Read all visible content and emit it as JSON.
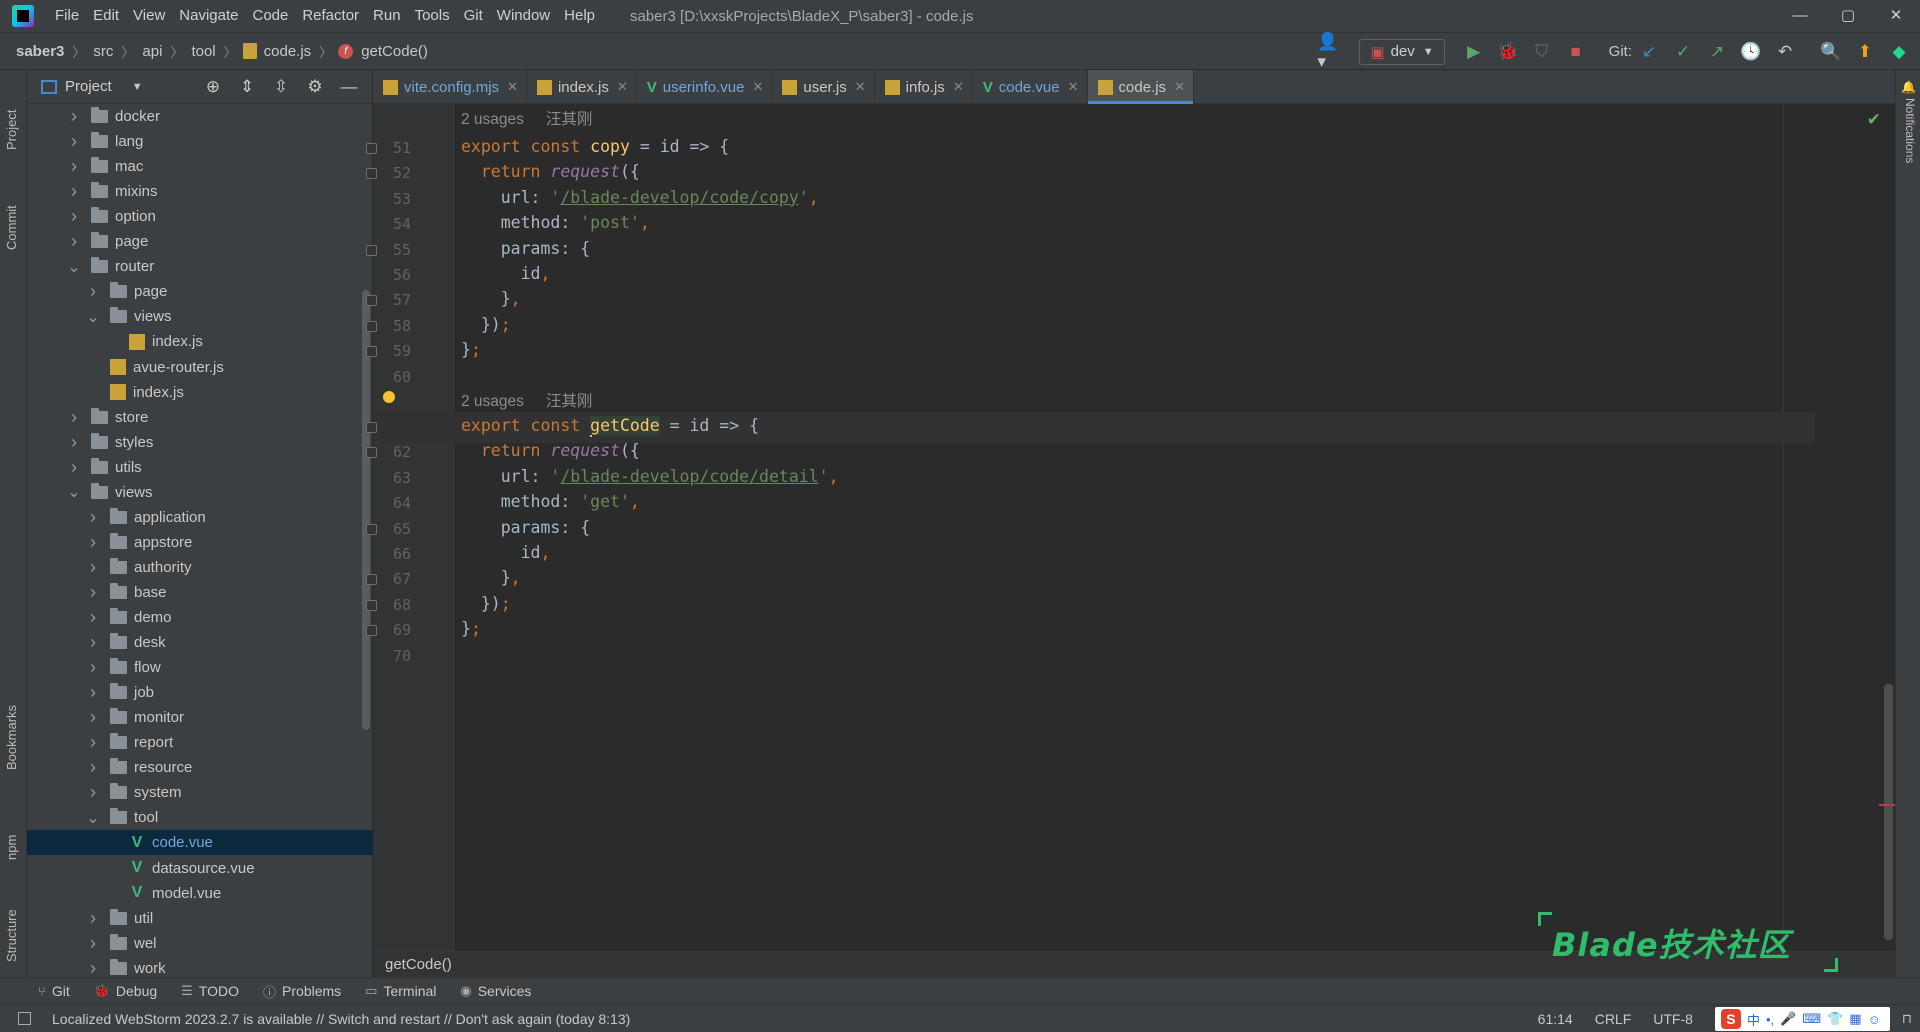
{
  "menubar": {
    "items": [
      "File",
      "Edit",
      "View",
      "Navigate",
      "Code",
      "Refactor",
      "Run",
      "Tools",
      "Git",
      "Window",
      "Help"
    ],
    "window_title": "saber3 [D:\\xxskProjects\\BladeX_P\\saber3] - code.js",
    "controls": [
      "—",
      "▢",
      "✕"
    ]
  },
  "navbar": {
    "crumbs": [
      "saber3",
      "src",
      "api",
      "tool",
      "code.js",
      "getCode()"
    ],
    "branch": "dev",
    "git_label": "Git:"
  },
  "left_strip": {
    "tabs": [
      "Project",
      "Commit",
      "Bookmarks",
      "npm",
      "Structure"
    ]
  },
  "right_strip": {
    "tabs": [
      "Notifications"
    ]
  },
  "project_panel": {
    "title": "Project",
    "tree": [
      {
        "label": "docker",
        "type": "folder",
        "depth": 0,
        "state": "collapsed"
      },
      {
        "label": "lang",
        "type": "folder",
        "depth": 0,
        "state": "collapsed"
      },
      {
        "label": "mac",
        "type": "folder",
        "depth": 0,
        "state": "collapsed"
      },
      {
        "label": "mixins",
        "type": "folder",
        "depth": 0,
        "state": "collapsed"
      },
      {
        "label": "option",
        "type": "folder",
        "depth": 0,
        "state": "collapsed"
      },
      {
        "label": "page",
        "type": "folder",
        "depth": 0,
        "state": "collapsed"
      },
      {
        "label": "router",
        "type": "folder",
        "depth": 0,
        "state": "expanded"
      },
      {
        "label": "page",
        "type": "folder",
        "depth": 1,
        "state": "collapsed"
      },
      {
        "label": "views",
        "type": "folder",
        "depth": 1,
        "state": "expanded"
      },
      {
        "label": "index.js",
        "type": "js",
        "depth": 2,
        "state": "leaf"
      },
      {
        "label": "avue-router.js",
        "type": "js",
        "depth": 1,
        "state": "leaf"
      },
      {
        "label": "index.js",
        "type": "js",
        "depth": 1,
        "state": "leaf"
      },
      {
        "label": "store",
        "type": "folder",
        "depth": 0,
        "state": "collapsed"
      },
      {
        "label": "styles",
        "type": "folder",
        "depth": 0,
        "state": "collapsed"
      },
      {
        "label": "utils",
        "type": "folder",
        "depth": 0,
        "state": "collapsed"
      },
      {
        "label": "views",
        "type": "folder",
        "depth": 0,
        "state": "expanded"
      },
      {
        "label": "application",
        "type": "folder",
        "depth": 1,
        "state": "collapsed"
      },
      {
        "label": "appstore",
        "type": "folder",
        "depth": 1,
        "state": "collapsed"
      },
      {
        "label": "authority",
        "type": "folder",
        "depth": 1,
        "state": "collapsed"
      },
      {
        "label": "base",
        "type": "folder",
        "depth": 1,
        "state": "collapsed"
      },
      {
        "label": "demo",
        "type": "folder",
        "depth": 1,
        "state": "collapsed"
      },
      {
        "label": "desk",
        "type": "folder",
        "depth": 1,
        "state": "collapsed"
      },
      {
        "label": "flow",
        "type": "folder",
        "depth": 1,
        "state": "collapsed"
      },
      {
        "label": "job",
        "type": "folder",
        "depth": 1,
        "state": "collapsed"
      },
      {
        "label": "monitor",
        "type": "folder",
        "depth": 1,
        "state": "collapsed"
      },
      {
        "label": "report",
        "type": "folder",
        "depth": 1,
        "state": "collapsed"
      },
      {
        "label": "resource",
        "type": "folder",
        "depth": 1,
        "state": "collapsed"
      },
      {
        "label": "system",
        "type": "folder",
        "depth": 1,
        "state": "collapsed"
      },
      {
        "label": "tool",
        "type": "folder",
        "depth": 1,
        "state": "expanded"
      },
      {
        "label": "code.vue",
        "type": "vue",
        "depth": 2,
        "state": "leaf",
        "selected": true
      },
      {
        "label": "datasource.vue",
        "type": "vue",
        "depth": 2,
        "state": "leaf"
      },
      {
        "label": "model.vue",
        "type": "vue",
        "depth": 2,
        "state": "leaf"
      },
      {
        "label": "util",
        "type": "folder",
        "depth": 1,
        "state": "collapsed"
      },
      {
        "label": "wel",
        "type": "folder",
        "depth": 1,
        "state": "collapsed"
      },
      {
        "label": "work",
        "type": "folder",
        "depth": 1,
        "state": "collapsed"
      }
    ]
  },
  "editor_tabs": [
    {
      "label": "vite.config.mjs",
      "type": "vite"
    },
    {
      "label": "index.js",
      "type": "js"
    },
    {
      "label": "userinfo.vue",
      "type": "vue"
    },
    {
      "label": "user.js",
      "type": "js"
    },
    {
      "label": "info.js",
      "type": "js"
    },
    {
      "label": "code.vue",
      "type": "vue"
    },
    {
      "label": "code.js",
      "type": "js",
      "active": true
    }
  ],
  "editor": {
    "inlays": [
      {
        "usages": "2 usages",
        "author": "汪其刚"
      },
      {
        "usages": "2 usages",
        "author": "汪其刚"
      }
    ],
    "lines": [
      {
        "n": "51",
        "tokens": [
          [
            "kw",
            "export const "
          ],
          [
            "fn-def",
            "copy"
          ],
          [
            "p",
            " = id => {"
          ]
        ]
      },
      {
        "n": "52",
        "tokens": [
          [
            "p",
            "  "
          ],
          [
            "kw",
            "return "
          ],
          [
            "fn-call",
            "request"
          ],
          [
            "p",
            "({"
          ]
        ]
      },
      {
        "n": "53",
        "tokens": [
          [
            "p",
            "    url: "
          ],
          [
            "str",
            "'"
          ],
          [
            "stru",
            "/blade-develop/code/copy"
          ],
          [
            "str",
            "'"
          ],
          [
            "kw",
            ","
          ]
        ]
      },
      {
        "n": "54",
        "tokens": [
          [
            "p",
            "    method: "
          ],
          [
            "str",
            "'post'"
          ],
          [
            "kw",
            ","
          ]
        ]
      },
      {
        "n": "55",
        "tokens": [
          [
            "p",
            "    params: {"
          ]
        ]
      },
      {
        "n": "56",
        "tokens": [
          [
            "p",
            "      id"
          ],
          [
            "kw",
            ","
          ]
        ]
      },
      {
        "n": "57",
        "tokens": [
          [
            "p",
            "    }"
          ],
          [
            "kw",
            ","
          ]
        ]
      },
      {
        "n": "58",
        "tokens": [
          [
            "p",
            "  })"
          ],
          [
            "kw",
            ";"
          ]
        ]
      },
      {
        "n": "59",
        "tokens": [
          [
            "p",
            "}"
          ],
          [
            "kw",
            ";"
          ]
        ]
      },
      {
        "n": "60",
        "tokens": []
      },
      {
        "n": "61",
        "tokens": [
          [
            "kw",
            "export const "
          ],
          [
            "caret",
            ""
          ],
          [
            "fn-def hl",
            "getCode"
          ],
          [
            "p",
            " = id => {"
          ]
        ],
        "current": true
      },
      {
        "n": "62",
        "tokens": [
          [
            "p",
            "  "
          ],
          [
            "kw",
            "return "
          ],
          [
            "fn-call",
            "request"
          ],
          [
            "p",
            "({"
          ]
        ]
      },
      {
        "n": "63",
        "tokens": [
          [
            "p",
            "    url: "
          ],
          [
            "str",
            "'"
          ],
          [
            "stru",
            "/blade-develop/code/detail"
          ],
          [
            "str",
            "'"
          ],
          [
            "kw",
            ","
          ]
        ]
      },
      {
        "n": "64",
        "tokens": [
          [
            "p",
            "    method: "
          ],
          [
            "str",
            "'get'"
          ],
          [
            "kw",
            ","
          ]
        ]
      },
      {
        "n": "65",
        "tokens": [
          [
            "p",
            "    params: {"
          ]
        ]
      },
      {
        "n": "66",
        "tokens": [
          [
            "p",
            "      id"
          ],
          [
            "kw",
            ","
          ]
        ]
      },
      {
        "n": "67",
        "tokens": [
          [
            "p",
            "    }"
          ],
          [
            "kw",
            ","
          ]
        ]
      },
      {
        "n": "68",
        "tokens": [
          [
            "p",
            "  })"
          ],
          [
            "kw",
            ";"
          ]
        ]
      },
      {
        "n": "69",
        "tokens": [
          [
            "p",
            "}"
          ],
          [
            "kw",
            ";"
          ]
        ]
      },
      {
        "n": "70",
        "tokens": []
      }
    ],
    "breadcrumb": "getCode()"
  },
  "bottom_tabs": [
    {
      "label": "Git",
      "icon": "git-icon"
    },
    {
      "label": "Debug",
      "icon": "bug-icon"
    },
    {
      "label": "TODO",
      "icon": "list-icon"
    },
    {
      "label": "Problems",
      "icon": "info-icon"
    },
    {
      "label": "Terminal",
      "icon": "terminal-icon"
    },
    {
      "label": "Services",
      "icon": "services-icon"
    }
  ],
  "status": {
    "message": "Localized WebStorm 2023.2.7 is available // Switch and restart // Don't ask again (today 8:13)",
    "position": "61:14",
    "line_sep": "CRLF",
    "encoding": "UTF-8",
    "ime": [
      "S",
      "中",
      "•,",
      "🎤",
      "⌨",
      "👕",
      "▦",
      "☺"
    ]
  },
  "watermark": {
    "text": "Blade技术社区"
  },
  "colors": {
    "accent": "#4a88c7",
    "keyword": "#cc7832",
    "function": "#ffc66d",
    "string": "#6a8759",
    "vue": "#41b883"
  }
}
